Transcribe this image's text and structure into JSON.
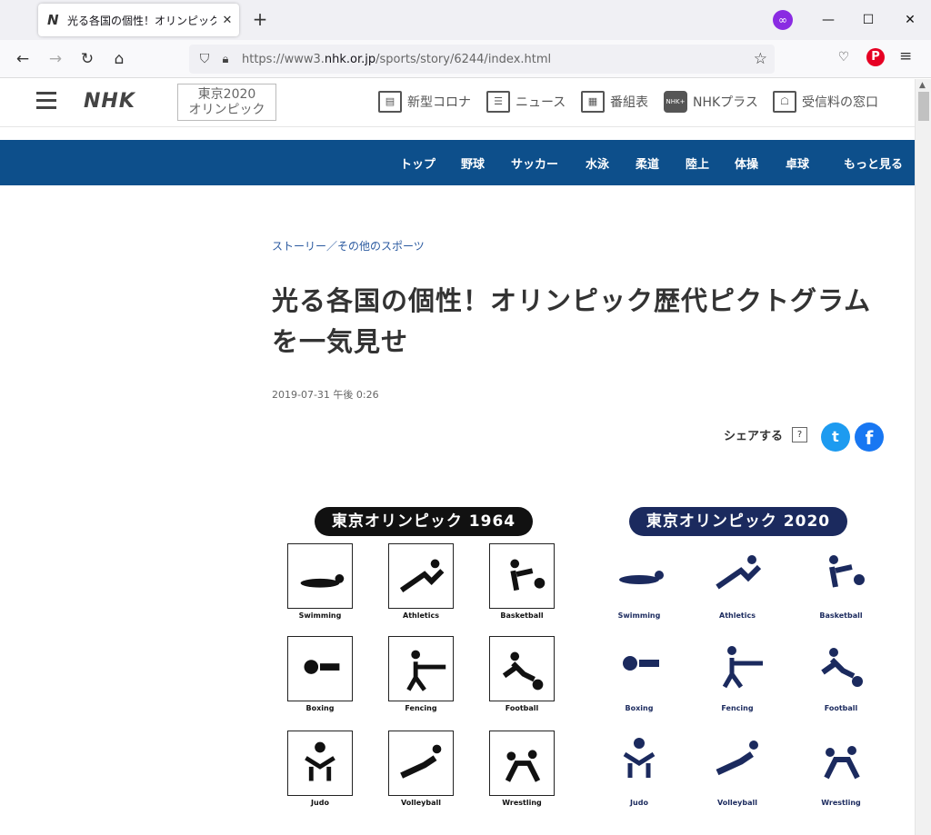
{
  "browser": {
    "tab_title": "光る各国の個性！オリンピック歴代",
    "tab_favicon": "N",
    "url_prefix": "https://www3.",
    "url_domain": "nhk.or.jp",
    "url_path": "/sports/story/6244/index.html"
  },
  "header": {
    "logo": "NHK",
    "tokyo_logo_line1": "東京2020",
    "tokyo_logo_line2": "オリンピック",
    "links": [
      {
        "label": "新型コロナ",
        "icon": "news-board-icon"
      },
      {
        "label": "ニュース",
        "icon": "newspaper-icon"
      },
      {
        "label": "番組表",
        "icon": "grid-schedule-icon"
      },
      {
        "label": "NHKプラス",
        "icon": "nhk-plus-icon",
        "icon_text": "NHK+"
      },
      {
        "label": "受信料の窓口",
        "icon": "reception-icon"
      }
    ]
  },
  "sports_nav": [
    "トップ",
    "野球",
    "サッカー",
    "水泳",
    "柔道",
    "陸上",
    "体操",
    "卓球",
    "もっと見る"
  ],
  "article": {
    "breadcrumb": "ストーリー／その他のスポーツ",
    "headline": "光る各国の個性！オリンピック歴代ピクトグラムを一気見せ",
    "date": "2019-07-31 午後 0:26",
    "share_label": "シェアする",
    "share_help": "?"
  },
  "figure": {
    "title_1964": "東京オリンピック 1964",
    "title_2020": "東京オリンピック 2020",
    "color_1964": "#111111",
    "color_2020": "#1b2a5e",
    "sports": [
      "Swimming",
      "Athletics",
      "Basketball",
      "Boxing",
      "Fencing",
      "Football",
      "Judo",
      "Volleyball",
      "Wrestling"
    ]
  }
}
